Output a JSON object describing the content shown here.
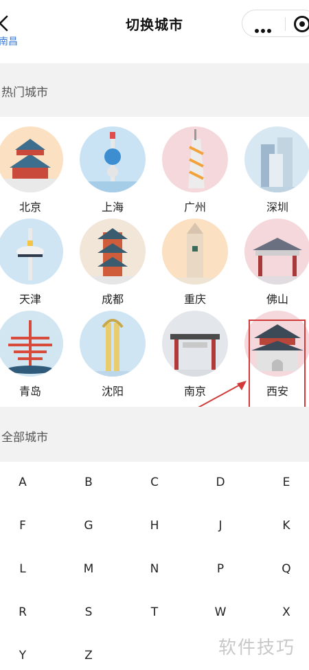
{
  "nav": {
    "title": "切换城市",
    "located_text": "南昌"
  },
  "hot_section": {
    "title": "热门城市"
  },
  "hot_cities": [
    {
      "name": "北京",
      "bg": "#fbe0c2"
    },
    {
      "name": "上海",
      "bg": "#c9e3f4"
    },
    {
      "name": "广州",
      "bg": "#f5d8dc"
    },
    {
      "name": "深圳",
      "bg": "#d7e8f3"
    },
    {
      "name": "天津",
      "bg": "#cfe5f4"
    },
    {
      "name": "成都",
      "bg": "#f1e6d8"
    },
    {
      "name": "重庆",
      "bg": "#fbe0c2"
    },
    {
      "name": "佛山",
      "bg": "#f5d8dc"
    },
    {
      "name": "青岛",
      "bg": "#d2e6f2"
    },
    {
      "name": "沈阳",
      "bg": "#cfe5f4"
    },
    {
      "name": "南京",
      "bg": "#e3e6ea"
    },
    {
      "name": "西安",
      "bg": "#f5d8dc"
    }
  ],
  "all_section": {
    "title": "全部城市"
  },
  "letters": [
    "A",
    "B",
    "C",
    "D",
    "E",
    "F",
    "G",
    "H",
    "J",
    "K",
    "L",
    "M",
    "N",
    "P",
    "Q",
    "R",
    "S",
    "T",
    "W",
    "X",
    "Y",
    "Z"
  ],
  "colors": {
    "accent_red": "#d23a3a",
    "link_blue": "#3a7bd5"
  },
  "watermark": "软件技巧"
}
